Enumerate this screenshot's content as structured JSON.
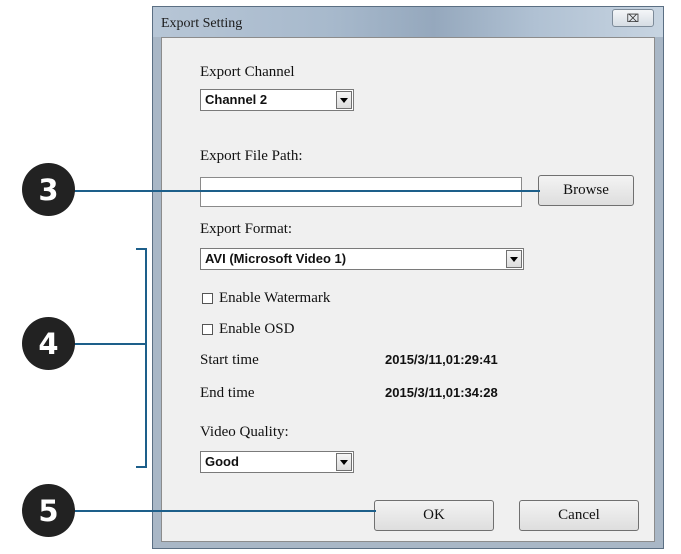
{
  "window": {
    "title": "Export Setting",
    "close_glyph": "⌧"
  },
  "form": {
    "export_channel_label": "Export Channel",
    "export_channel_value": "Channel 2",
    "export_file_path_label": "Export File Path:",
    "export_file_path_value": "",
    "browse_label": "Browse",
    "export_format_label": "Export Format:",
    "export_format_value": "AVI (Microsoft Video 1)",
    "enable_watermark_label": "Enable Watermark",
    "enable_watermark_checked": false,
    "enable_osd_label": "Enable OSD",
    "enable_osd_checked": false,
    "start_time_label": "Start time",
    "start_time_value": "2015/3/11,01:29:41",
    "end_time_label": "End time",
    "end_time_value": "2015/3/11,01:34:28",
    "video_quality_label": "Video Quality:",
    "video_quality_value": "Good",
    "ok_label": "OK",
    "cancel_label": "Cancel"
  },
  "callouts": [
    {
      "number": "3"
    },
    {
      "number": "4"
    },
    {
      "number": "5"
    }
  ],
  "colors": {
    "callout_line": "#1d5f8a",
    "callout_circle": "#222222"
  }
}
